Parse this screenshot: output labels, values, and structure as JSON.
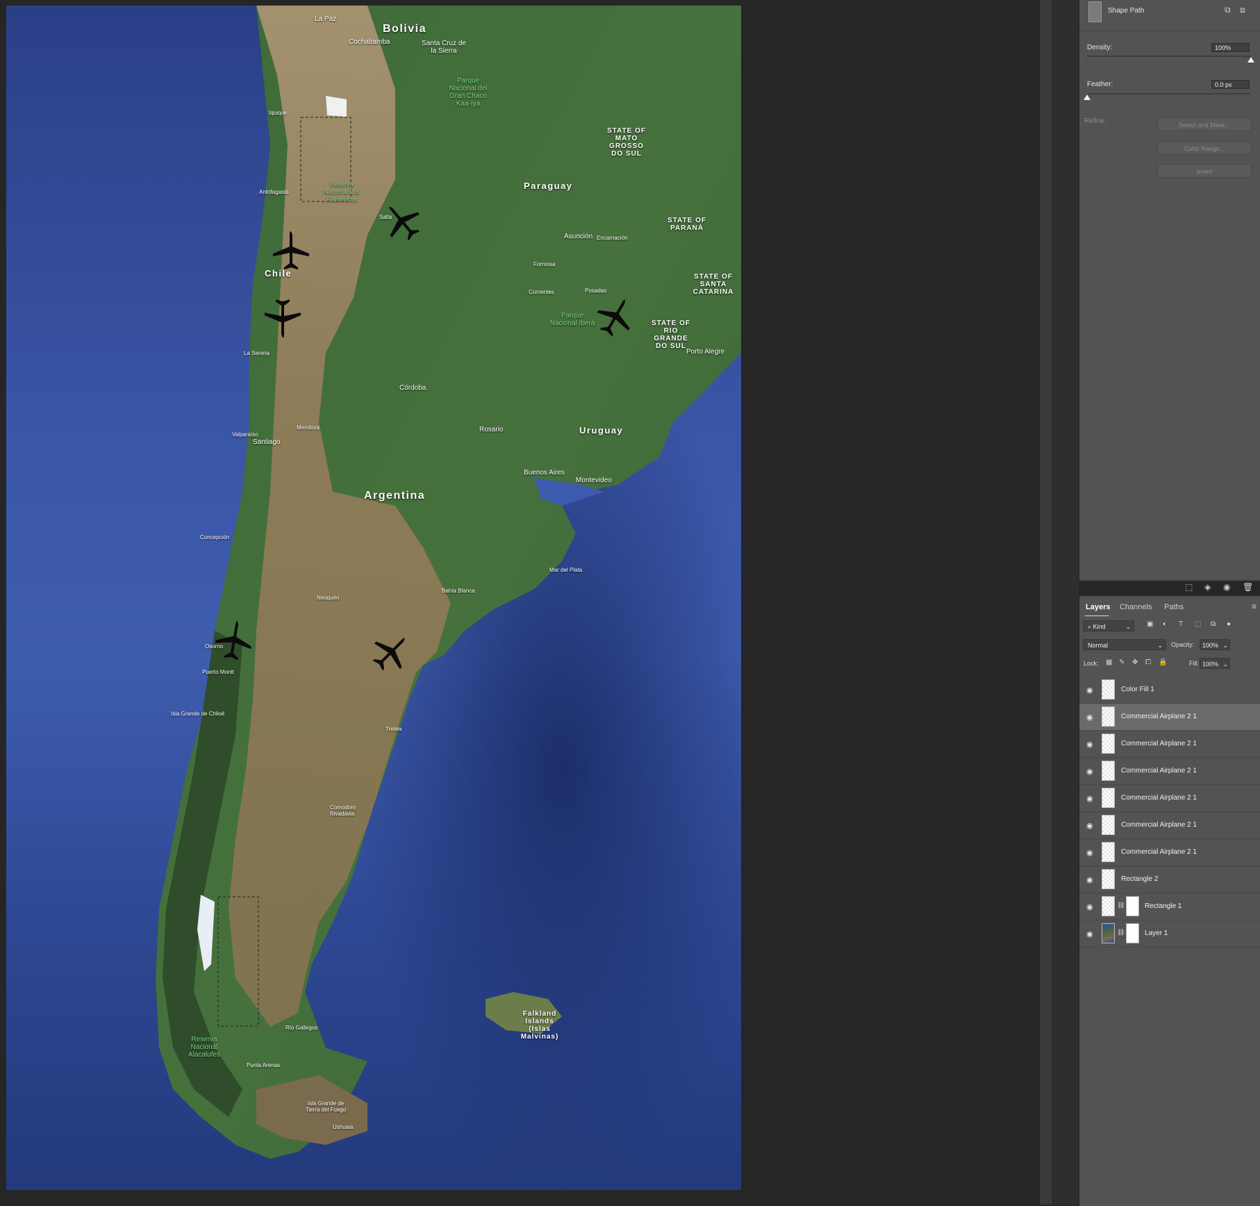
{
  "map": {
    "countries": {
      "bolivia": "Bolivia",
      "paraguay": "Paraguay",
      "chile": "Chile",
      "argentina": "Argentina",
      "uruguay": "Uruguay"
    },
    "states": {
      "mato_grosso": "STATE OF MATO GROSSO DO SUL",
      "parana": "STATE OF PARANÁ",
      "santa_catarina": "STATE OF SANTA CATARINA",
      "rio_grande": "STATE OF RIO GRANDE DO SUL"
    },
    "cities": {
      "la_paz": "La Paz",
      "cochabamba": "Cochabamba",
      "santa_cruz": "Santa Cruz de la Sierra",
      "asuncion": "Asunción",
      "cordoba": "Córdoba",
      "rosario": "Rosario",
      "santiago": "Santiago",
      "buenos_aires": "Buenos Aires",
      "montevideo": "Montevideo",
      "porto_alegre": "Porto Alegre",
      "salta": "Salta",
      "mendoza": "Mendoza",
      "neuquen": "Neuquén",
      "bahia_blanca": "Bahía Blanca",
      "mar_del_plata": "Mar del Plata",
      "puerto_montt": "Puerto Montt",
      "osorno": "Osorno",
      "valparaiso": "Valparaíso",
      "concepcion": "Concepción",
      "antofagasta": "Antofagasta",
      "iquique": "Iquique",
      "la_serena": "La Serena",
      "rio_gallegos": "Río Gallegos",
      "punta_arenas": "Punta Arenas",
      "ushuaia": "Ushuaia",
      "trelew": "Trelew",
      "comodoro": "Comodoro Rivadavia",
      "corrientes": "Corrientes",
      "posadas": "Posadas",
      "formosa": "Formosa",
      "encarnacion": "Encarnación",
      "isla_chiloe": "Isla Grande de Chiloé",
      "tierra_fuego": "Isla Grande de Tierra del Fuego"
    },
    "parks": {
      "gran_chaco": "Parque Nacional del Gran Chaco Kaa-Iya",
      "ibera": "Parque Nacional Iberá",
      "alacalufes": "Reserva Nacional Alacalufes",
      "flamencos": "Reserva Nacional Los Flamencos"
    },
    "islands": {
      "falkland": "Falkland Islands (Islas Malvinas)"
    }
  },
  "properties": {
    "shape_label": "Shape Path",
    "density_label": "Density:",
    "density_value": "100%",
    "density_level": 1.0,
    "feather_label": "Feather:",
    "feather_value": "0.0 px",
    "feather_level": 0.0,
    "refine_label": "Refine:",
    "buttons": [
      "Select and Mask...",
      "Color Range...",
      "Invert"
    ]
  },
  "layers_panel": {
    "tabs": [
      "Layers",
      "Channels",
      "Paths"
    ],
    "filter": "Kind",
    "blend_mode": "Normal",
    "opacity_label": "Opacity:",
    "opacity_value": "100%",
    "lock_label": "Lock:",
    "fill_label": "Fill:",
    "fill_value": "100%",
    "layers": [
      {
        "name": "Color Fill 1"
      },
      {
        "name": "Commercial Airplane 2 1",
        "selected": true
      },
      {
        "name": "Commercial Airplane 2 1"
      },
      {
        "name": "Commercial Airplane 2 1"
      },
      {
        "name": "Commercial Airplane 2 1"
      },
      {
        "name": "Commercial Airplane 2 1"
      },
      {
        "name": "Commercial Airplane 2 1"
      },
      {
        "name": "Rectangle 2"
      },
      {
        "name": "Rectangle 1",
        "mask": true
      },
      {
        "name": "Layer 1",
        "mask": true
      }
    ]
  },
  "icons": {
    "eye": "eye-icon",
    "plane": "airplane-icon",
    "link": "link-icon"
  },
  "colors": {
    "ocean": "#3e5cae",
    "land_green": "#3f6b3a",
    "land_brown": "#8a7352",
    "panel": "#535353",
    "app_bg": "#262626"
  }
}
